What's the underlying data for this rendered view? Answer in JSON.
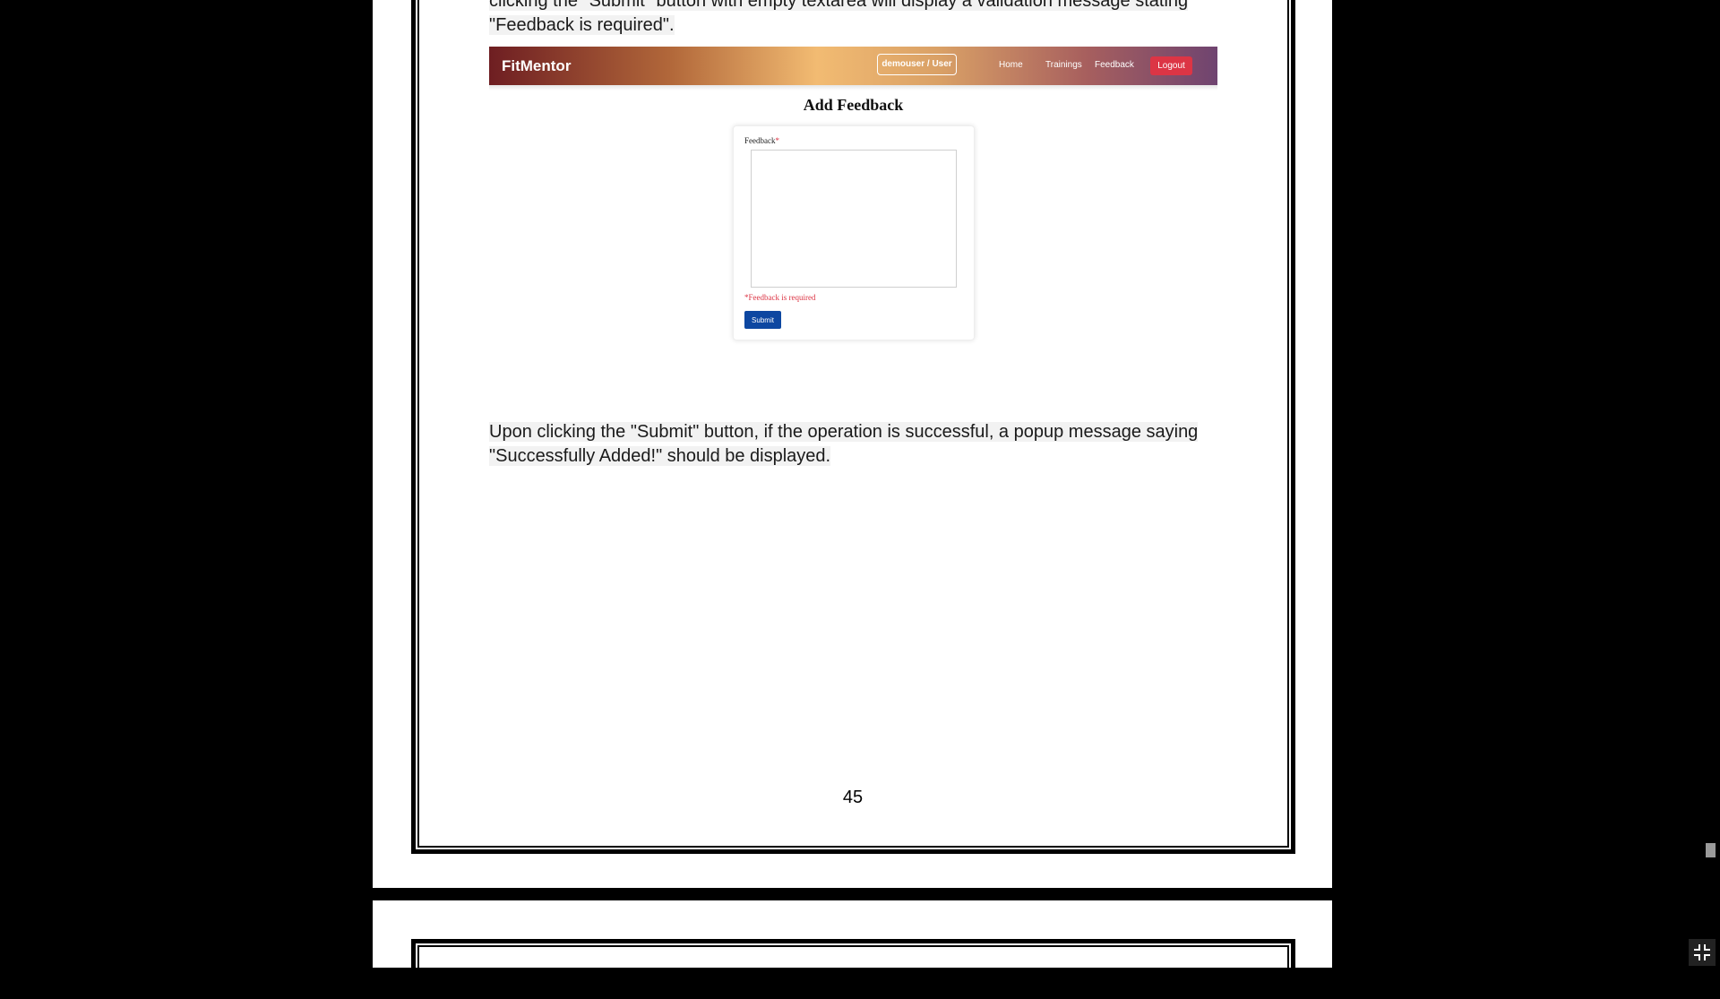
{
  "document": {
    "top_paragraph_partial": "clicking the \"Submit\" button with empty textarea will display a validation message stating",
    "top_paragraph_end": "\"Feedback is required\".",
    "screenshot": {
      "brand": "FitMentor",
      "user_badge": "demouser / User",
      "nav_links": [
        "Home",
        "Trainings",
        "Feedback"
      ],
      "logout_label": "Logout",
      "form_title": "Add Feedback",
      "field_label": "Feedback",
      "required_mark": "*",
      "textarea_value": "",
      "error_message": "*Feedback is required",
      "submit_label": "Submit"
    },
    "body_paragraph_line1": "Upon clicking the \"Submit\" button, if the operation is successful, a popup message saying",
    "body_paragraph_line2": "\"Successfully Added!\" should be displayed.",
    "page_number": "45"
  },
  "colors": {
    "background": "#000000",
    "page": "#ffffff",
    "accent_error": "#dc3545",
    "submit_button": "#0d47a1"
  },
  "icons": {
    "fullscreen_exit": "exit-fullscreen-icon"
  }
}
